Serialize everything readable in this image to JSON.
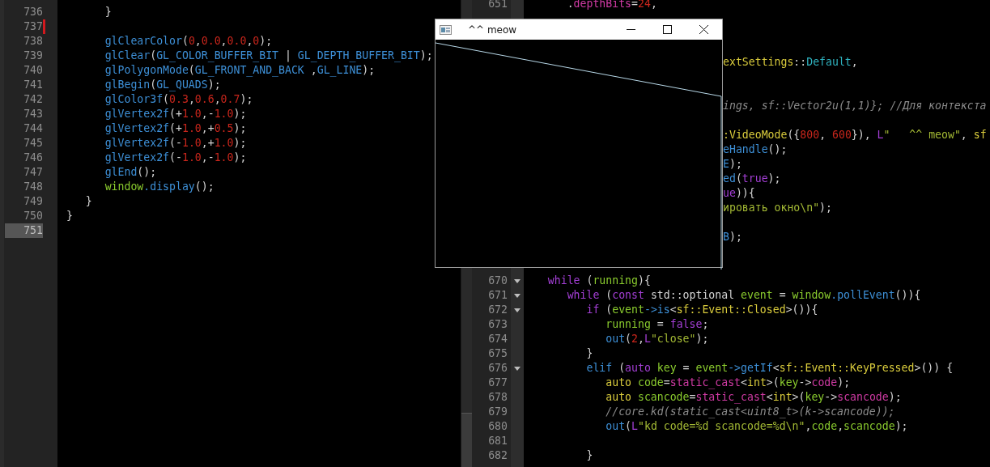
{
  "left_editor": {
    "lines": [
      {
        "number": "736",
        "changed": false,
        "current": false,
        "tokens": [
          {
            "kind": "p",
            "text": "      }"
          }
        ]
      },
      {
        "number": "737",
        "changed": true,
        "current": false
      },
      {
        "number": "738",
        "changed": false,
        "current": false,
        "tokens": [
          {
            "kind": "fn",
            "text": "      glClearColor"
          },
          {
            "kind": "p",
            "text": "("
          },
          {
            "kind": "num",
            "text": "0"
          },
          {
            "kind": "p",
            "text": ","
          },
          {
            "kind": "num",
            "text": "0.0"
          },
          {
            "kind": "p",
            "text": ","
          },
          {
            "kind": "num",
            "text": "0.0"
          },
          {
            "kind": "p",
            "text": ","
          },
          {
            "kind": "num",
            "text": "0"
          },
          {
            "kind": "p",
            "text": ");"
          }
        ]
      },
      {
        "number": "739",
        "changed": false,
        "current": false,
        "tokens": [
          {
            "kind": "fn",
            "text": "      glClear"
          },
          {
            "kind": "p",
            "text": "("
          },
          {
            "kind": "fn",
            "text": "GL_COLOR_BUFFER_BIT"
          },
          {
            "kind": "p",
            "text": " | "
          },
          {
            "kind": "fn",
            "text": "GL_DEPTH_BUFFER_BIT"
          },
          {
            "kind": "p",
            "text": ");"
          }
        ]
      },
      {
        "number": "740",
        "changed": false,
        "current": false,
        "tokens": [
          {
            "kind": "fn",
            "text": "      glPolygonMode"
          },
          {
            "kind": "p",
            "text": "("
          },
          {
            "kind": "fn",
            "text": "GL_FRONT_AND_BACK"
          },
          {
            "kind": "p",
            "text": " ,"
          },
          {
            "kind": "fn",
            "text": "GL_LINE"
          },
          {
            "kind": "p",
            "text": ");"
          }
        ]
      },
      {
        "number": "741",
        "changed": false,
        "current": false,
        "tokens": [
          {
            "kind": "fn",
            "text": "      glBegin"
          },
          {
            "kind": "p",
            "text": "("
          },
          {
            "kind": "fn",
            "text": "GL_QUADS"
          },
          {
            "kind": "p",
            "text": ");"
          }
        ]
      },
      {
        "number": "742",
        "changed": false,
        "current": false,
        "tokens": [
          {
            "kind": "fn",
            "text": "      glColor3f"
          },
          {
            "kind": "p",
            "text": "("
          },
          {
            "kind": "num",
            "text": "0.3"
          },
          {
            "kind": "p",
            "text": ","
          },
          {
            "kind": "num",
            "text": "0.6"
          },
          {
            "kind": "p",
            "text": ","
          },
          {
            "kind": "num",
            "text": "0.7"
          },
          {
            "kind": "p",
            "text": ");"
          }
        ]
      },
      {
        "number": "743",
        "changed": false,
        "current": false,
        "tokens": [
          {
            "kind": "fn",
            "text": "      glVertex2f"
          },
          {
            "kind": "p",
            "text": "(+"
          },
          {
            "kind": "num",
            "text": "1.0"
          },
          {
            "kind": "p",
            "text": ",-"
          },
          {
            "kind": "num",
            "text": "1.0"
          },
          {
            "kind": "p",
            "text": ");"
          }
        ]
      },
      {
        "number": "744",
        "changed": false,
        "current": false,
        "tokens": [
          {
            "kind": "fn",
            "text": "      glVertex2f"
          },
          {
            "kind": "p",
            "text": "(+"
          },
          {
            "kind": "num",
            "text": "1.0"
          },
          {
            "kind": "p",
            "text": ",+"
          },
          {
            "kind": "num",
            "text": "0.5"
          },
          {
            "kind": "p",
            "text": ");"
          }
        ]
      },
      {
        "number": "745",
        "changed": false,
        "current": false,
        "tokens": [
          {
            "kind": "fn",
            "text": "      glVertex2f"
          },
          {
            "kind": "p",
            "text": "(-"
          },
          {
            "kind": "num",
            "text": "1.0"
          },
          {
            "kind": "p",
            "text": ",+"
          },
          {
            "kind": "num",
            "text": "1.0"
          },
          {
            "kind": "p",
            "text": ");"
          }
        ]
      },
      {
        "number": "746",
        "changed": false,
        "current": false,
        "tokens": [
          {
            "kind": "fn",
            "text": "      glVertex2f"
          },
          {
            "kind": "p",
            "text": "(-"
          },
          {
            "kind": "num",
            "text": "1.0"
          },
          {
            "kind": "p",
            "text": ",-"
          },
          {
            "kind": "num",
            "text": "1.0"
          },
          {
            "kind": "p",
            "text": ");"
          }
        ]
      },
      {
        "number": "747",
        "changed": false,
        "current": false,
        "tokens": [
          {
            "kind": "fn",
            "text": "      glEnd"
          },
          {
            "kind": "p",
            "text": "();"
          }
        ]
      },
      {
        "number": "748",
        "changed": false,
        "current": false,
        "tokens": [
          {
            "kind": "var",
            "text": "      window"
          },
          {
            "kind": "fn",
            "text": ".display"
          },
          {
            "kind": "p",
            "text": "();"
          }
        ]
      },
      {
        "number": "749",
        "changed": false,
        "current": false,
        "tokens": [
          {
            "kind": "p",
            "text": "   }"
          }
        ]
      },
      {
        "number": "750",
        "changed": false,
        "current": false,
        "tokens": [
          {
            "kind": "p",
            "text": "}"
          }
        ]
      },
      {
        "number": "751",
        "changed": false,
        "current": true
      }
    ]
  },
  "right_editor": {
    "lines": [
      {
        "kind": "line",
        "number": "651",
        "foldable": false,
        "tokens": [
          {
            "kind": "p",
            "text": "      ."
          },
          {
            "kind": "mem",
            "text": "depthBits"
          },
          {
            "kind": "p",
            "text": "="
          },
          {
            "kind": "num",
            "text": "24"
          },
          {
            "kind": "p",
            "text": ","
          }
        ]
      },
      {
        "kind": "covered"
      },
      {
        "kind": "covered"
      },
      {
        "kind": "covered"
      },
      {
        "kind": "covered",
        "tokens": [
          {
            "kind": "type",
            "text": "extSettings"
          },
          {
            "kind": "p",
            "text": "::"
          },
          {
            "kind": "const",
            "text": "Default"
          },
          {
            "kind": "p",
            "text": ","
          }
        ]
      },
      {
        "kind": "covered"
      },
      {
        "kind": "covered"
      },
      {
        "kind": "covered",
        "tokens": [
          {
            "kind": "cmt",
            "text": "ings, sf::Vector2u(1,1)}; //Для контекста"
          }
        ]
      },
      {
        "kind": "covered"
      },
      {
        "kind": "covered",
        "tokens": [
          {
            "kind": "type",
            "text": ":VideoMode"
          },
          {
            "kind": "p",
            "text": "({"
          },
          {
            "kind": "num",
            "text": "800"
          },
          {
            "kind": "p",
            "text": ", "
          },
          {
            "kind": "num",
            "text": "600"
          },
          {
            "kind": "p",
            "text": "}), "
          },
          {
            "kind": "kw",
            "text": "L"
          },
          {
            "kind": "str",
            "text": "\"   ^^ meow\""
          },
          {
            "kind": "p",
            "text": ", "
          },
          {
            "kind": "type",
            "text": "sf"
          }
        ]
      },
      {
        "kind": "covered",
        "tokens": [
          {
            "kind": "fn",
            "text": "eHandle"
          },
          {
            "kind": "p",
            "text": "();"
          }
        ]
      },
      {
        "kind": "covered",
        "tokens": [
          {
            "kind": "fn",
            "text": "E"
          },
          {
            "kind": "p",
            "text": ");"
          }
        ]
      },
      {
        "kind": "covered",
        "tokens": [
          {
            "kind": "fn",
            "text": "ed"
          },
          {
            "kind": "p",
            "text": "("
          },
          {
            "kind": "kw",
            "text": "true"
          },
          {
            "kind": "p",
            "text": ");"
          }
        ]
      },
      {
        "kind": "covered",
        "tokens": [
          {
            "kind": "kw",
            "text": "ue"
          },
          {
            "kind": "p",
            "text": ")){"
          }
        ]
      },
      {
        "kind": "covered",
        "tokens": [
          {
            "kind": "str",
            "text": "ировать окно\\n\""
          },
          {
            "kind": "p",
            "text": ");"
          }
        ]
      },
      {
        "kind": "covered"
      },
      {
        "kind": "covered",
        "tokens": [
          {
            "kind": "fn",
            "text": "B"
          },
          {
            "kind": "p",
            "text": ");"
          }
        ]
      },
      {
        "kind": "covered"
      },
      {
        "kind": "covered"
      },
      {
        "kind": "line",
        "number": "670",
        "foldable": true,
        "tokens": [
          {
            "kind": "kw",
            "text": "   while"
          },
          {
            "kind": "p",
            "text": " ("
          },
          {
            "kind": "var",
            "text": "running"
          },
          {
            "kind": "p",
            "text": "){"
          }
        ]
      },
      {
        "kind": "line",
        "number": "671",
        "foldable": true,
        "tokens": [
          {
            "kind": "kw",
            "text": "      while"
          },
          {
            "kind": "p",
            "text": " ("
          },
          {
            "kind": "kw",
            "text": "const"
          },
          {
            "kind": "p",
            "text": " std::optional "
          },
          {
            "kind": "var",
            "text": "event"
          },
          {
            "kind": "p",
            "text": " = "
          },
          {
            "kind": "var",
            "text": "window"
          },
          {
            "kind": "fn",
            "text": ".pollEvent"
          },
          {
            "kind": "p",
            "text": "()){"
          }
        ]
      },
      {
        "kind": "line",
        "number": "672",
        "foldable": true,
        "tokens": [
          {
            "kind": "kw",
            "text": "         if"
          },
          {
            "kind": "p",
            "text": " ("
          },
          {
            "kind": "var",
            "text": "event"
          },
          {
            "kind": "fn",
            "text": "->is"
          },
          {
            "kind": "p",
            "text": "<"
          },
          {
            "kind": "type",
            "text": "sf::Event::Closed"
          },
          {
            "kind": "p",
            "text": ">()){"
          }
        ]
      },
      {
        "kind": "line",
        "number": "673",
        "foldable": false,
        "tokens": [
          {
            "kind": "var",
            "text": "            running"
          },
          {
            "kind": "p",
            "text": " = "
          },
          {
            "kind": "kw",
            "text": "false"
          },
          {
            "kind": "p",
            "text": ";"
          }
        ]
      },
      {
        "kind": "line",
        "number": "674",
        "foldable": false,
        "tokens": [
          {
            "kind": "fn",
            "text": "            out"
          },
          {
            "kind": "p",
            "text": "("
          },
          {
            "kind": "num",
            "text": "2"
          },
          {
            "kind": "p",
            "text": ","
          },
          {
            "kind": "kw",
            "text": "L"
          },
          {
            "kind": "str",
            "text": "\"close\""
          },
          {
            "kind": "p",
            "text": ");"
          }
        ]
      },
      {
        "kind": "line",
        "number": "675",
        "foldable": false,
        "tokens": [
          {
            "kind": "p",
            "text": "         }"
          }
        ]
      },
      {
        "kind": "line",
        "number": "676",
        "foldable": true,
        "tokens": [
          {
            "kind": "fn",
            "text": "         elif"
          },
          {
            "kind": "p",
            "text": " ("
          },
          {
            "kind": "kw",
            "text": "auto"
          },
          {
            "kind": "var",
            "text": " key"
          },
          {
            "kind": "p",
            "text": " = "
          },
          {
            "kind": "var",
            "text": "event"
          },
          {
            "kind": "fn",
            "text": "->getIf"
          },
          {
            "kind": "p",
            "text": "<"
          },
          {
            "kind": "type",
            "text": "sf::Event::KeyPressed"
          },
          {
            "kind": "p",
            "text": ">()) {"
          }
        ]
      },
      {
        "kind": "line",
        "number": "677",
        "foldable": false,
        "tokens": [
          {
            "kind": "type",
            "text": "            auto"
          },
          {
            "kind": "var",
            "text": " code"
          },
          {
            "kind": "p",
            "text": "="
          },
          {
            "kind": "mem",
            "text": "static_cast"
          },
          {
            "kind": "p",
            "text": "<"
          },
          {
            "kind": "type",
            "text": "int"
          },
          {
            "kind": "p",
            "text": ">("
          },
          {
            "kind": "var",
            "text": "key"
          },
          {
            "kind": "p",
            "text": "->"
          },
          {
            "kind": "mem",
            "text": "code"
          },
          {
            "kind": "p",
            "text": ");"
          }
        ]
      },
      {
        "kind": "line",
        "number": "678",
        "foldable": false,
        "tokens": [
          {
            "kind": "type",
            "text": "            auto"
          },
          {
            "kind": "var",
            "text": " scancode"
          },
          {
            "kind": "p",
            "text": "="
          },
          {
            "kind": "mem",
            "text": "static_cast"
          },
          {
            "kind": "p",
            "text": "<"
          },
          {
            "kind": "type",
            "text": "int"
          },
          {
            "kind": "p",
            "text": ">("
          },
          {
            "kind": "var",
            "text": "key"
          },
          {
            "kind": "p",
            "text": "->"
          },
          {
            "kind": "mem",
            "text": "scancode"
          },
          {
            "kind": "p",
            "text": ");"
          }
        ]
      },
      {
        "kind": "line",
        "number": "679",
        "foldable": false,
        "tokens": [
          {
            "kind": "cmt",
            "text": "            //core.kd(static_cast<uint8_t>(k->scancode));"
          }
        ]
      },
      {
        "kind": "line",
        "number": "680",
        "foldable": false,
        "tokens": [
          {
            "kind": "fn",
            "text": "            out"
          },
          {
            "kind": "p",
            "text": "("
          },
          {
            "kind": "kw",
            "text": "L"
          },
          {
            "kind": "str",
            "text": "\"kd code=%d scancode=%d\\n\""
          },
          {
            "kind": "p",
            "text": ","
          },
          {
            "kind": "var",
            "text": "code"
          },
          {
            "kind": "p",
            "text": ","
          },
          {
            "kind": "var",
            "text": "scancode"
          },
          {
            "kind": "p",
            "text": ");"
          }
        ]
      },
      {
        "kind": "line",
        "number": "681",
        "foldable": false
      },
      {
        "kind": "line",
        "number": "682",
        "foldable": false,
        "tokens": [
          {
            "kind": "p",
            "text": "         }"
          }
        ]
      }
    ]
  },
  "app_window": {
    "title": "^^ meow"
  }
}
